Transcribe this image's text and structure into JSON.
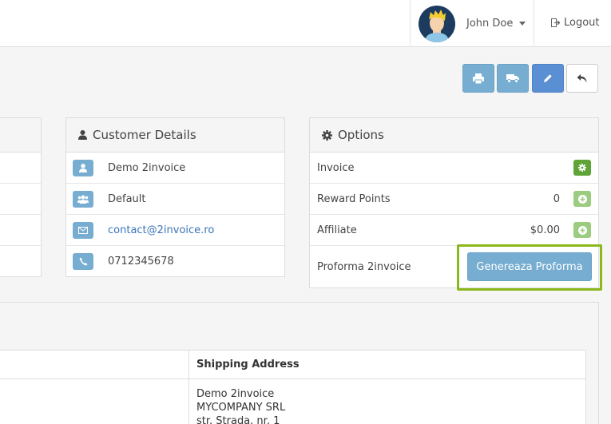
{
  "header": {
    "user_name": "John Doe",
    "logout_label": "Logout"
  },
  "toolbar": {
    "print_icon": "print-icon",
    "shipping_icon": "truck-icon",
    "edit_icon": "pencil-icon",
    "back_icon": "reply-icon"
  },
  "customer": {
    "title": "Customer Details",
    "rows": [
      {
        "icon": "user-icon",
        "text": "Demo 2invoice"
      },
      {
        "icon": "group-icon",
        "text": "Default"
      },
      {
        "icon": "envelope-icon",
        "text": "contact@2invoice.ro"
      },
      {
        "icon": "phone-icon",
        "text": "0712345678"
      }
    ]
  },
  "options": {
    "title": "Options",
    "rows": [
      {
        "label": "Invoice",
        "value": ""
      },
      {
        "label": "Reward Points",
        "value": "0"
      },
      {
        "label": "Affiliate",
        "value": "$0.00"
      },
      {
        "label": "Proforma 2invoice",
        "value": ""
      }
    ],
    "proforma_button": "Genereaza Proforma"
  },
  "address_table": {
    "shipping_header": "Shipping Address",
    "shipping_lines": [
      "Demo 2invoice",
      "MYCOMPANY SRL",
      "str. Strada, nr. 1"
    ]
  },
  "colors": {
    "info": "#76add0",
    "primary": "#5b8fd4",
    "success": "#5fa437",
    "highlight": "#8ab81e"
  }
}
